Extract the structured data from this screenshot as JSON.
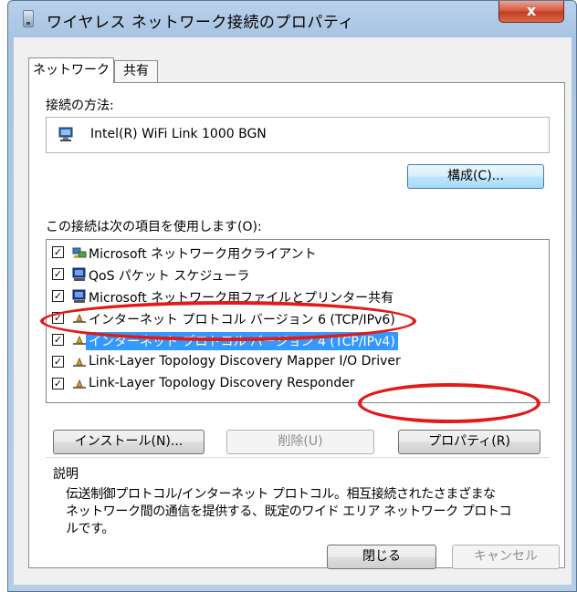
{
  "window": {
    "title": "ワイヤレス ネットワーク接続のプロパティ",
    "close_label": "x"
  },
  "tabs": [
    {
      "label": "ネットワーク",
      "active": true
    },
    {
      "label": "共有",
      "active": false
    }
  ],
  "connect_using": {
    "label": "接続の方法:",
    "adapter": "Intel(R) WiFi Link 1000 BGN",
    "configure_button": "構成(C)..."
  },
  "items_section": {
    "label": "この接続は次の項目を使用します(O):",
    "items": [
      {
        "label": "Microsoft ネットワーク用クライアント",
        "checked": true,
        "icon": "network-client-icon",
        "selected": false
      },
      {
        "label": "QoS パケット スケジューラ",
        "checked": true,
        "icon": "computer-service-icon",
        "selected": false
      },
      {
        "label": "Microsoft ネットワーク用ファイルとプリンター共有",
        "checked": true,
        "icon": "computer-service-icon",
        "selected": false
      },
      {
        "label": "インターネット プロトコル バージョン 6 (TCP/IPv6)",
        "checked": true,
        "icon": "protocol-icon",
        "selected": false
      },
      {
        "label": "インターネット プロトコル バージョン 4 (TCP/IPv4)",
        "checked": true,
        "icon": "protocol-icon",
        "selected": true
      },
      {
        "label": "Link-Layer Topology Discovery Mapper I/O Driver",
        "checked": true,
        "icon": "protocol-icon",
        "selected": false
      },
      {
        "label": "Link-Layer Topology Discovery Responder",
        "checked": true,
        "icon": "protocol-icon",
        "selected": false
      }
    ]
  },
  "item_buttons": {
    "install": "インストール(N)...",
    "uninstall": "削除(U)",
    "properties": "プロパティ(R)"
  },
  "description": {
    "heading": "説明",
    "line1": "伝送制御プロトコル/インターネット プロトコル。相互接続されたさまざまな",
    "line2": "ネットワーク間の通信を提供する、既定のワイド エリア ネットワーク プロトコ",
    "line3": "ルです。"
  },
  "footer": {
    "close": "閉じる",
    "cancel": "キャンセル"
  },
  "colors": {
    "selection": "#3399ff",
    "annotation": "#e11a1a",
    "close_button": "#c9452a"
  }
}
